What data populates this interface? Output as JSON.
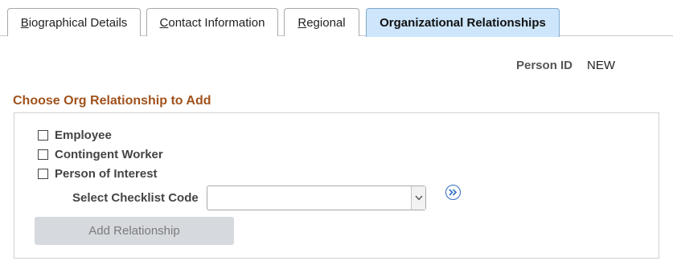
{
  "tabs": [
    {
      "prefix": "",
      "accel": "B",
      "rest": "iographical Details",
      "active": false
    },
    {
      "prefix": "",
      "accel": "C",
      "rest": "ontact Information",
      "active": false
    },
    {
      "prefix": "",
      "accel": "R",
      "rest": "egional",
      "active": false
    },
    {
      "prefix": "",
      "accel": "",
      "rest": "Organizational Relationships",
      "active": true
    }
  ],
  "person": {
    "label": "Person ID",
    "value": "NEW"
  },
  "section": {
    "title": "Choose Org Relationship to Add"
  },
  "options": [
    {
      "label": "Employee",
      "checked": false
    },
    {
      "label": "Contingent Worker",
      "checked": false
    },
    {
      "label": "Person of Interest",
      "checked": false
    }
  ],
  "checklist": {
    "label": "Select Checklist Code",
    "value": ""
  },
  "actions": {
    "add_label": "Add Relationship"
  },
  "icons": {
    "lookup": "double-chevron-right-icon",
    "dropdown": "chevron-down-icon"
  },
  "colors": {
    "accent": "#a0521d",
    "active_tab": "#cde6fb",
    "link": "#2e6ac0",
    "disabled_button": "#d6d9de"
  }
}
